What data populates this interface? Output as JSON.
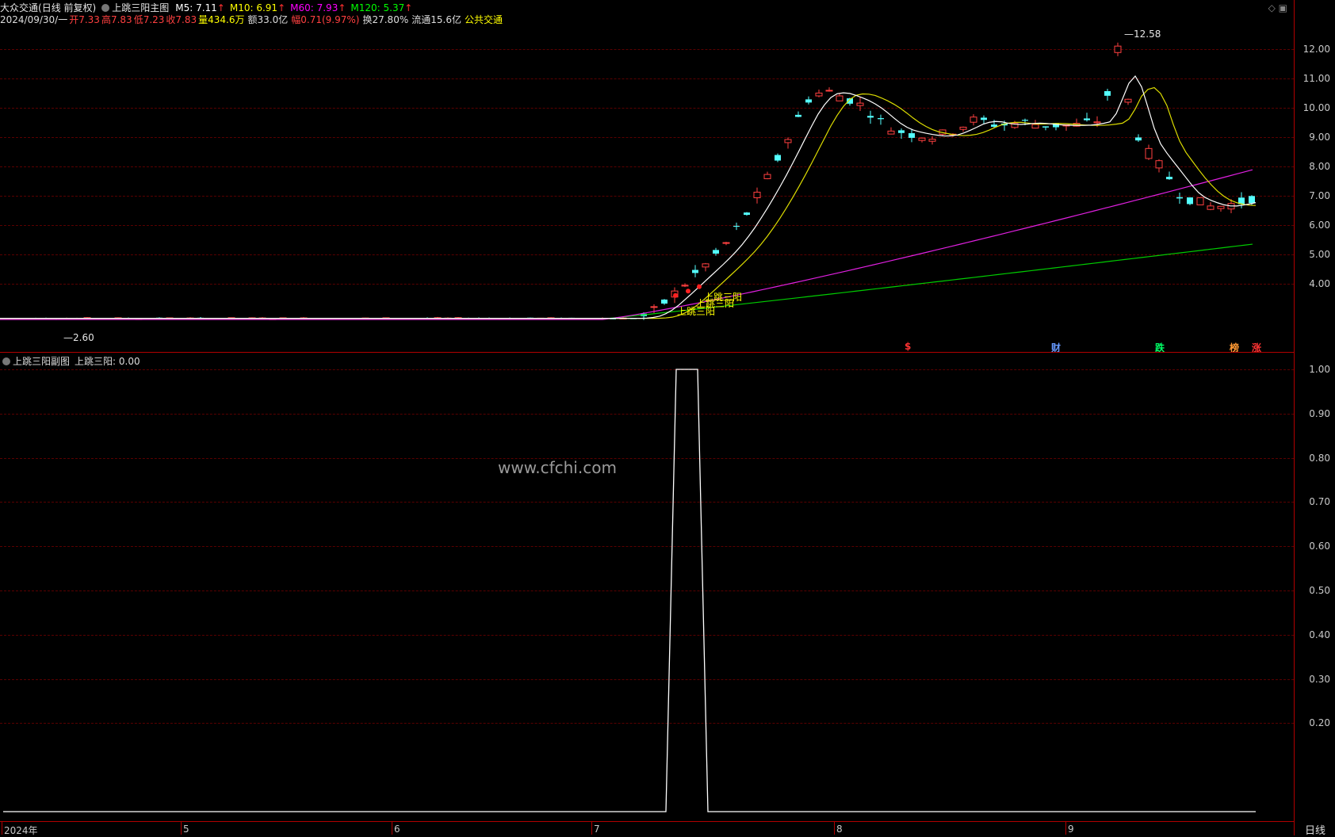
{
  "header": {
    "stock_name": "大众交通",
    "adjust_mode": "(日线 前复权)",
    "indicator_name": "上跳三阳主图",
    "ma": [
      {
        "label": "M5: 7.11",
        "arrow": "↑",
        "color": "#ffffff"
      },
      {
        "label": "M10: 6.91",
        "arrow": "↑",
        "color": "#ffff00"
      },
      {
        "label": "M60: 7.93",
        "arrow": "↑",
        "color": "#ff00ff"
      },
      {
        "label": "M120: 5.37",
        "arrow": "↑",
        "color": "#00ff00"
      }
    ],
    "date": "2024/09/30/一",
    "open": "开7.33",
    "high": "高7.83",
    "low": "低7.23",
    "close": "收7.83",
    "volume": "量434.6万",
    "amount": "额33.0亿",
    "change": "幅0.71(9.97%)",
    "turnover": "换27.80%",
    "float": "流通15.6亿",
    "sector": "公共交通"
  },
  "top_icons": "◇ ▣",
  "main_chart": {
    "y_ticks": [
      "12.00",
      "11.00",
      "10.00",
      "9.00",
      "8.00",
      "7.00",
      "6.00",
      "5.00",
      "4.00"
    ],
    "high_label": "12.58",
    "low_label": "2.60",
    "signal_labels": [
      "上跳三阳",
      "上跳三阳",
      "上跳三阳"
    ],
    "events": [
      {
        "text": "$",
        "color": "#ff3333"
      },
      {
        "text": "财",
        "color": "#6699ff"
      },
      {
        "text": "跌",
        "color": "#00ff66"
      },
      {
        "text": "榜",
        "color": "#ff9933"
      },
      {
        "text": "涨",
        "color": "#ff3333"
      }
    ]
  },
  "sub_chart": {
    "title": "上跳三阳副图",
    "value_label": "上跳三阳: 0.00",
    "y_ticks": [
      "1.00",
      "0.90",
      "0.80",
      "0.70",
      "0.60",
      "0.50",
      "0.40",
      "0.30",
      "0.20"
    ]
  },
  "x_axis": {
    "labels": [
      "2024年",
      "5",
      "6",
      "7",
      "8",
      "9"
    ]
  },
  "period": "日线",
  "watermark": "www.cfchi.com",
  "chart_data": [
    {
      "type": "candlestick",
      "title": "上跳三阳主图",
      "ylim": [
        2.6,
        12.6
      ],
      "series": [
        {
          "name": "M5",
          "last": 7.11
        },
        {
          "name": "M10",
          "last": 6.91
        },
        {
          "name": "M60",
          "last": 7.93
        },
        {
          "name": "M120",
          "last": 5.37
        }
      ],
      "price_high": 12.58,
      "price_low": 2.6,
      "last_bar": {
        "open": 7.33,
        "high": 7.83,
        "low": 7.23,
        "close": 7.83
      }
    },
    {
      "type": "line",
      "title": "上跳三阳副图",
      "ylim": [
        0,
        1
      ],
      "series": [
        {
          "name": "上跳三阳",
          "values": [
            0,
            0,
            1,
            1,
            0,
            0
          ]
        }
      ],
      "x": [
        "2024年",
        "7",
        "7",
        "7",
        "8",
        "9"
      ]
    }
  ]
}
